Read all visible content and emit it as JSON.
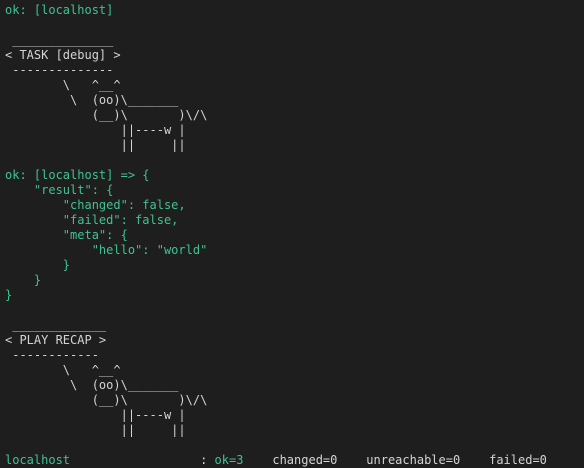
{
  "terminal": {
    "lines": [
      {
        "text": "ok: [localhost]",
        "color": "green"
      },
      {
        "text": "",
        "color": "white"
      },
      {
        "text": " ______________",
        "color": "white"
      },
      {
        "text": "< TASK [debug] >",
        "color": "white"
      },
      {
        "text": " --------------",
        "color": "white"
      },
      {
        "text": "        \\   ^__^",
        "color": "white"
      },
      {
        "text": "         \\  (oo)\\_______",
        "color": "white"
      },
      {
        "text": "            (__)\\       )\\/\\",
        "color": "white"
      },
      {
        "text": "                ||----w |",
        "color": "white"
      },
      {
        "text": "                ||     ||",
        "color": "white"
      },
      {
        "text": "",
        "color": "white"
      },
      {
        "text": "ok: [localhost] => {",
        "color": "green"
      },
      {
        "text": "    \"result\": {",
        "color": "green"
      },
      {
        "text": "        \"changed\": false,",
        "color": "green"
      },
      {
        "text": "        \"failed\": false,",
        "color": "green"
      },
      {
        "text": "        \"meta\": {",
        "color": "green"
      },
      {
        "text": "            \"hello\": \"world\"",
        "color": "green"
      },
      {
        "text": "        }",
        "color": "green"
      },
      {
        "text": "    }",
        "color": "green"
      },
      {
        "text": "}",
        "color": "green"
      },
      {
        "text": "",
        "color": "white"
      },
      {
        "text": " _____________",
        "color": "white"
      },
      {
        "text": "< PLAY RECAP >",
        "color": "white"
      },
      {
        "text": " ------------",
        "color": "white"
      },
      {
        "text": "        \\   ^__^",
        "color": "white"
      },
      {
        "text": "         \\  (oo)\\_______",
        "color": "white"
      },
      {
        "text": "            (__)\\       )\\/\\",
        "color": "white"
      },
      {
        "text": "                ||----w |",
        "color": "white"
      },
      {
        "text": "                ||     ||",
        "color": "white"
      },
      {
        "text": "",
        "color": "white"
      }
    ],
    "recap": {
      "host": "localhost",
      "padding": "                  ",
      "colon": ": ",
      "ok": "ok=3",
      "gap1": "    ",
      "changed": "changed=0",
      "gap2": "    ",
      "unreachable": "unreachable=0",
      "gap3": "    ",
      "failed": "failed=0"
    }
  },
  "colors": {
    "background": "#1e1e1e",
    "foreground": "#d4d4d4",
    "ok_green": "#3ec38f"
  }
}
